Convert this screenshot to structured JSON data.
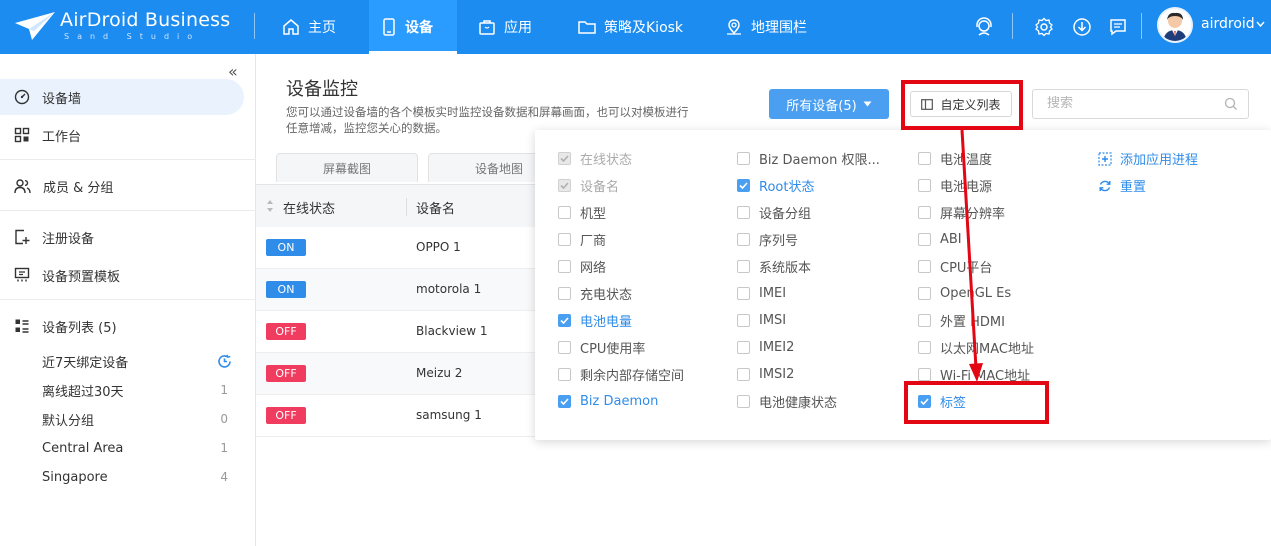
{
  "app": {
    "brand": "AirDroid Business",
    "subtitle": "Sand Studio",
    "username": "airdroid"
  },
  "nav": [
    {
      "label": "主页",
      "icon": "home-icon",
      "active": false
    },
    {
      "label": "设备",
      "icon": "device-icon",
      "active": true
    },
    {
      "label": "应用",
      "icon": "app-bag-icon",
      "active": false
    },
    {
      "label": "策略及Kiosk",
      "icon": "folder-icon",
      "active": false
    },
    {
      "label": "地理围栏",
      "icon": "geofence-icon",
      "active": false
    }
  ],
  "topIcons": [
    "support-agent-icon",
    "settings-icon",
    "download-icon",
    "message-icon"
  ],
  "sidebar": {
    "items": [
      {
        "label": "设备墙",
        "icon": "device-wall-icon",
        "active": true
      },
      {
        "label": "工作台",
        "icon": "workbench-icon"
      },
      {
        "label": "成员 & 分组",
        "icon": "members-icon"
      },
      {
        "label": "注册设备",
        "icon": "register-device-icon"
      },
      {
        "label": "设备预置模板",
        "icon": "template-icon"
      },
      {
        "label": "设备列表 (5)",
        "icon": "device-list-icon"
      }
    ],
    "groups": [
      {
        "label": "近7天绑定设备",
        "count": ""
      },
      {
        "label": "离线超过30天",
        "count": "1"
      },
      {
        "label": "默认分组",
        "count": "0"
      },
      {
        "label": "Central Area",
        "count": "1"
      },
      {
        "label": "Singapore",
        "count": "4"
      }
    ]
  },
  "main": {
    "title": "设备监控",
    "description": "您可以通过设备墙的各个模板实时监控设备数据和屏幕画面，也可以对模板进行任意增减，监控您关心的数据。",
    "tabs": [
      "屏幕截图",
      "设备地图"
    ],
    "allDevicesButton": "所有设备(5)",
    "customColumnsButton": "自定义列表",
    "searchPlaceholder": "搜索",
    "table": {
      "headers": [
        "在线状态",
        "设备名"
      ],
      "rows": [
        {
          "status": "ON",
          "name": "OPPO 1"
        },
        {
          "status": "ON",
          "name": "motorola 1"
        },
        {
          "status": "OFF",
          "name": "Blackview 1"
        },
        {
          "status": "OFF",
          "name": "Meizu 2"
        },
        {
          "status": "OFF",
          "name": "samsung 1"
        }
      ]
    }
  },
  "columnPanel": {
    "col1": [
      {
        "label": "在线状态",
        "state": "disabled"
      },
      {
        "label": "设备名",
        "state": "disabled"
      },
      {
        "label": "机型",
        "state": "off"
      },
      {
        "label": "厂商",
        "state": "off"
      },
      {
        "label": "网络",
        "state": "off"
      },
      {
        "label": "充电状态",
        "state": "off"
      },
      {
        "label": "电池电量",
        "state": "checked"
      },
      {
        "label": "CPU使用率",
        "state": "off"
      },
      {
        "label": "剩余内部存储空间",
        "state": "off"
      },
      {
        "label": "Biz Daemon",
        "state": "checked"
      }
    ],
    "col2": [
      {
        "label": "Biz Daemon 权限...",
        "state": "off"
      },
      {
        "label": "Root状态",
        "state": "checked"
      },
      {
        "label": "设备分组",
        "state": "off"
      },
      {
        "label": "序列号",
        "state": "off"
      },
      {
        "label": "系统版本",
        "state": "off"
      },
      {
        "label": "IMEI",
        "state": "off"
      },
      {
        "label": "IMSI",
        "state": "off"
      },
      {
        "label": "IMEI2",
        "state": "off"
      },
      {
        "label": "IMSI2",
        "state": "off"
      },
      {
        "label": "电池健康状态",
        "state": "off"
      }
    ],
    "col3": [
      {
        "label": "电池温度",
        "state": "off"
      },
      {
        "label": "电池电源",
        "state": "off"
      },
      {
        "label": "屏幕分辨率",
        "state": "off"
      },
      {
        "label": "ABI",
        "state": "off"
      },
      {
        "label": "CPU平台",
        "state": "off"
      },
      {
        "label": "OpenGL Es",
        "state": "off"
      },
      {
        "label": "外置 HDMI",
        "state": "off"
      },
      {
        "label": "以太网MAC地址",
        "state": "off"
      },
      {
        "label": "Wi-Fi MAC地址",
        "state": "off"
      },
      {
        "label": "标签",
        "state": "checked"
      }
    ],
    "actions": {
      "addProcess": "添加应用进程",
      "reset": "重置"
    }
  },
  "colors": {
    "accent": "#1c8cf0",
    "on": "#2f8ce8",
    "off": "#f03c5f",
    "highlight": "#e30613"
  }
}
